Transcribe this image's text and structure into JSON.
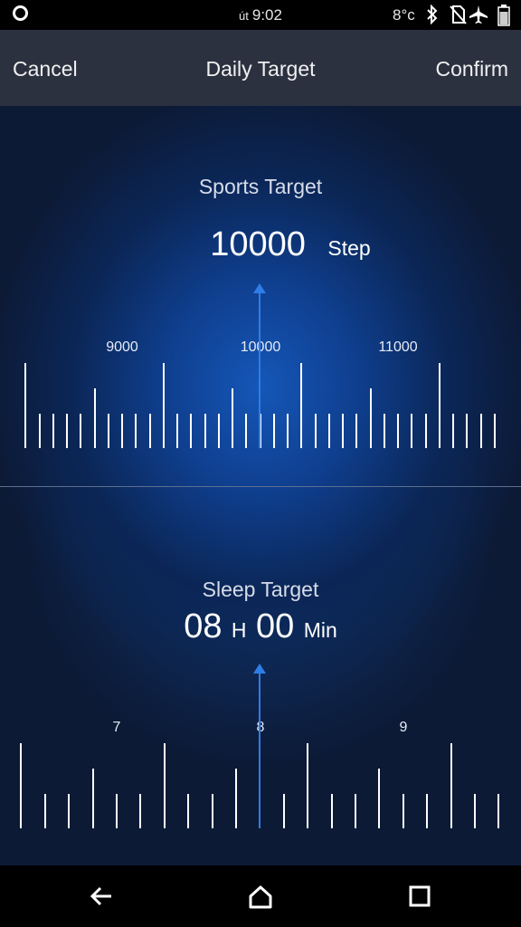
{
  "status_bar": {
    "day": "út",
    "time": "9:02",
    "temperature": "8°c",
    "icons": [
      "circle-icon",
      "bluetooth-icon",
      "no-sim-icon",
      "airplane-icon",
      "battery-icon"
    ]
  },
  "header": {
    "cancel_label": "Cancel",
    "title": "Daily Target",
    "confirm_label": "Confirm"
  },
  "sports": {
    "title": "Sports Target",
    "value": "10000",
    "unit": "Step",
    "scale_labels": [
      "9000",
      "10000",
      "11000"
    ],
    "selected": 10000
  },
  "sleep": {
    "title": "Sleep Target",
    "hours": "08",
    "hours_unit": "H",
    "minutes": "00",
    "minutes_unit": "Min",
    "scale_labels": [
      "7",
      "8",
      "9"
    ],
    "selected_hours": 8
  },
  "nav_bar": {
    "icons": [
      "back-icon",
      "home-icon",
      "recents-icon"
    ]
  },
  "colors": {
    "accent": "#2f7de6",
    "header_bg": "#2c3140",
    "content_bg": "#0c1a36"
  }
}
